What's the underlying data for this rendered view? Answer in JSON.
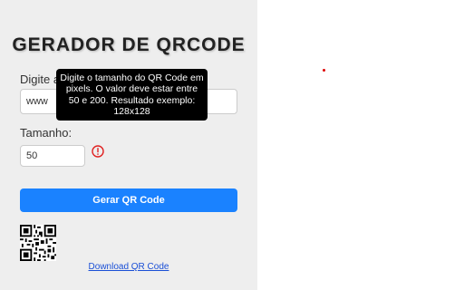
{
  "app": {
    "title": "GERADOR DE QRCODE"
  },
  "form": {
    "url_label": "Digite a",
    "url_value": "www",
    "size_label": "Tamanho:",
    "size_value": "50",
    "warning_icon": "exclamation-circle-icon",
    "generate_label": "Gerar QR Code",
    "download_label": "Download QR Code"
  },
  "tooltip": {
    "text": "Digite o tamanho do QR Code em pixels. O valor deve estar entre 50 e 200. Resultado exemplo: 128x128"
  },
  "colors": {
    "accent": "#1a82ff",
    "warning": "#e02020",
    "link": "#1a4fd6"
  }
}
